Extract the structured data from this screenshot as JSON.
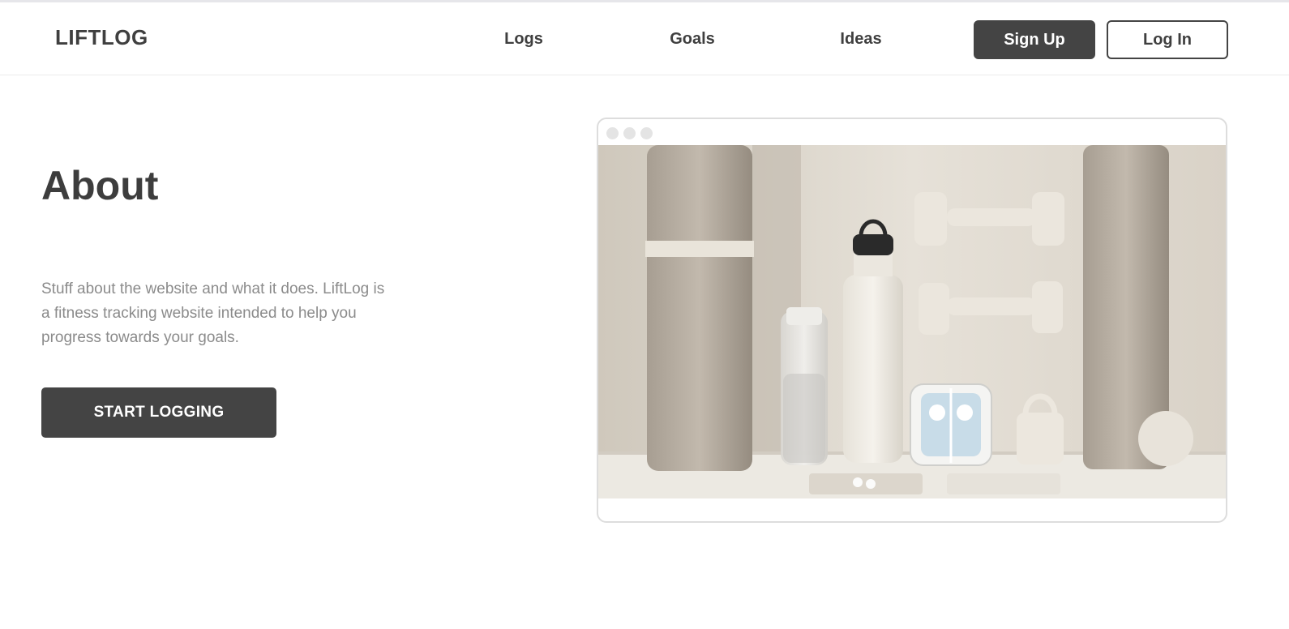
{
  "header": {
    "logo": "LIFTLOG",
    "nav": [
      "Logs",
      "Goals",
      "Ideas"
    ],
    "signup_label": "Sign Up",
    "login_label": "Log In"
  },
  "about": {
    "title": "About",
    "text": "Stuff about the website and what it does. LiftLog is a fitness tracking website intended to help you progress towards your goals.",
    "cta_label": "START LOGGING"
  },
  "colors": {
    "primary_dark": "#444444",
    "text_muted": "#8b8b8b",
    "background": "#ffffff"
  }
}
